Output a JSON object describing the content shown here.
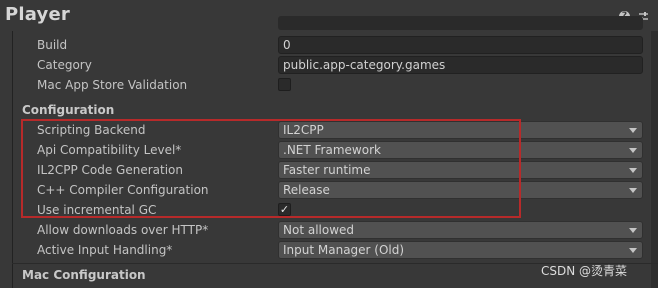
{
  "header": {
    "title": "Player",
    "help_icon": "help-icon",
    "settings_icon": "sliders-icon"
  },
  "rows": {
    "build": {
      "label": "Build",
      "value": "0"
    },
    "category": {
      "label": "Category",
      "value": "public.app-category.games"
    },
    "mac_validation": {
      "label": "Mac App Store Validation",
      "checked": false
    }
  },
  "configuration": {
    "header": "Configuration",
    "scripting_backend": {
      "label": "Scripting Backend",
      "value": "IL2CPP"
    },
    "api_compat": {
      "label": "Api Compatibility Level*",
      "value": ".NET Framework"
    },
    "il2cpp_codegen": {
      "label": "IL2CPP Code Generation",
      "value": "Faster runtime"
    },
    "cpp_compiler": {
      "label": "C++ Compiler Configuration",
      "value": "Release"
    },
    "incremental_gc": {
      "label": "Use incremental GC",
      "checked": true,
      "check_glyph": "✓"
    },
    "downloads_http": {
      "label": "Allow downloads over HTTP*",
      "value": "Not allowed"
    },
    "input_handling": {
      "label": "Active Input Handling*",
      "value": "Input Manager (Old)"
    }
  },
  "mac_configuration": {
    "header": "Mac Configuration"
  },
  "watermark": "CSDN @烫青菜",
  "colors": {
    "highlight": "#b72a2a",
    "background": "#383838"
  }
}
